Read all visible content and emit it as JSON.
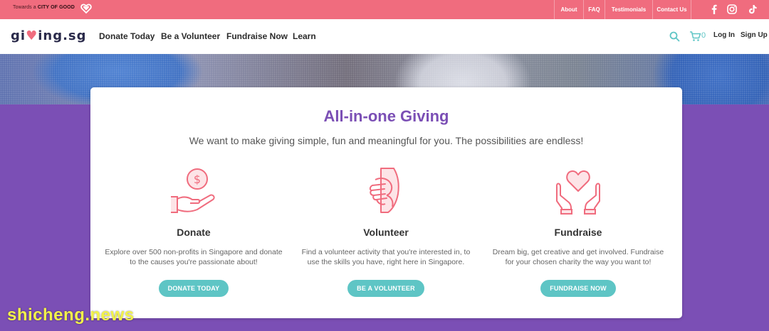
{
  "topbar": {
    "tagline_prefix": "Towards a",
    "tagline_bold": "CITY OF GOOD",
    "links": [
      "About",
      "FAQ",
      "Testimonials",
      "Contact Us"
    ],
    "social_icons": [
      "facebook-icon",
      "instagram-icon",
      "tiktok-icon"
    ]
  },
  "nav": {
    "logo_part1": "gi",
    "logo_heart": "♥",
    "logo_part2": "ing.sg",
    "links": [
      "Donate Today",
      "Be a Volunteer",
      "Fundraise Now",
      "Learn"
    ],
    "cart_count": "0",
    "login": "Log In",
    "signup": "Sign Up"
  },
  "card": {
    "title": "All-in-one Giving",
    "subtitle": "We want to make giving simple, fun and meaningful for you. The possibilities are endless!",
    "columns": [
      {
        "title": "Donate",
        "desc": "Explore over 500 non-profits in Singapore and donate to the causes you're passionate about!",
        "button": "DONATE TODAY",
        "icon": "donate-hand-coin-icon"
      },
      {
        "title": "Volunteer",
        "desc": "Find a volunteer activity that you're interested in, to use the skills you have, right here in Singapore.",
        "button": "BE A VOLUNTEER",
        "icon": "volunteer-hands-icon"
      },
      {
        "title": "Fundraise",
        "desc": "Dream big, get creative and get involved. Fundraise for your chosen charity the way you want to!",
        "button": "FUNDRAISE NOW",
        "icon": "fundraise-heart-hands-icon"
      }
    ]
  },
  "watermark": "shicheng.news",
  "colors": {
    "topbar": "#f06c7e",
    "purple": "#7b4fb5",
    "teal": "#5ec5c5",
    "icon_pink": "#f06c7e"
  }
}
